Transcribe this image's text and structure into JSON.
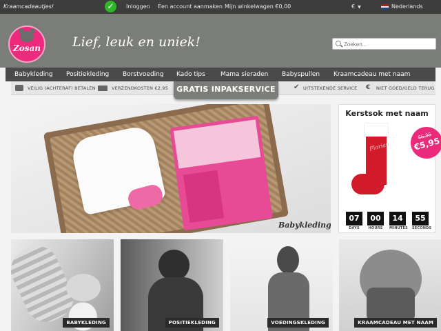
{
  "topbar": {
    "brand": "Kraamcadeautjes!",
    "login": "Inloggen",
    "create_account": "Een account aanmaken",
    "cart": "Mijn winkelwagen €0,00",
    "currency": "€",
    "language": "Nederlands"
  },
  "header": {
    "logo_text": "Zosan",
    "tagline": "Lief, leuk en uniek!",
    "search_placeholder": "Zoeken..."
  },
  "nav": {
    "items": [
      {
        "label": "Babykleding"
      },
      {
        "label": "Positiekleding"
      },
      {
        "label": "Borstvoeding"
      },
      {
        "label": "Kado tips"
      },
      {
        "label": "Mama sieraden"
      },
      {
        "label": "Babyspullen"
      },
      {
        "label": "Kraamcadeau met naam"
      }
    ]
  },
  "usp": {
    "secure_payment": "VEILIG (ACHTERAF) BETALEN",
    "shipping": "VERZENDKOSTEN €2,95",
    "gift_wrap": "GRATIS INPAKSERVICE",
    "service": "UITSTEKENDE SERVICE",
    "guarantee": "NIET GOED/GELD TERUG"
  },
  "hero": {
    "label": "Babykleding"
  },
  "promo": {
    "title": "Kerstsok met naam",
    "sock_name": "Florian",
    "old_price": "€6,95",
    "new_price": "€5,95",
    "countdown": [
      {
        "value": "07",
        "label": "DAYS"
      },
      {
        "value": "00",
        "label": "HOURS"
      },
      {
        "value": "14",
        "label": "MINUTES"
      },
      {
        "value": "55",
        "label": "SECONDS"
      }
    ]
  },
  "tiles": [
    {
      "caption": "BABYKLEDING"
    },
    {
      "caption": "POSITIEKLEDING"
    },
    {
      "caption": "VOEDINGSKLEDING"
    },
    {
      "caption": "KRAAMCADEAU MET NAAM"
    }
  ],
  "colors": {
    "topbar": "#3d3d3d",
    "header": "#7a7d78",
    "nav": "#4a4a4a",
    "brand_pink": "#ec2a7c",
    "check_green": "#2fb42a"
  }
}
